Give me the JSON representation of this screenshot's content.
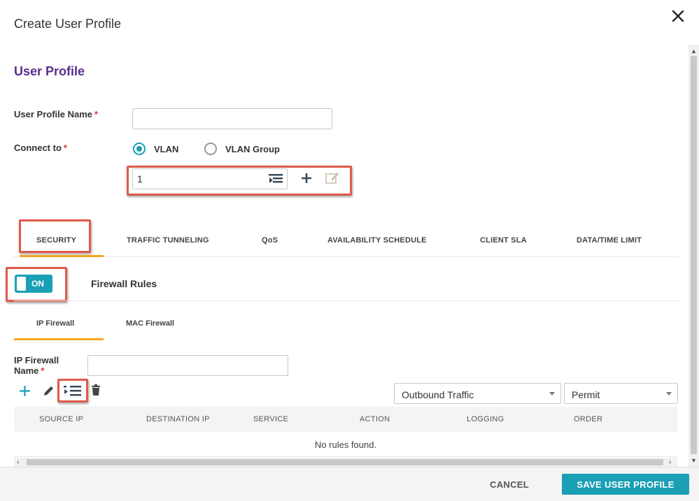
{
  "dialog": {
    "title": "Create User Profile"
  },
  "section": {
    "title": "User Profile"
  },
  "form": {
    "profile_name_label": "User Profile Name",
    "profile_name_value": "",
    "connect_label": "Connect to",
    "required_mark": "*",
    "radio_vlan": "VLAN",
    "radio_vlan_group": "VLAN Group",
    "selected": "VLAN",
    "vlan_value": "1"
  },
  "tabs": [
    {
      "label": "SECURITY",
      "active": true
    },
    {
      "label": "TRAFFIC TUNNELING"
    },
    {
      "label": "QoS"
    },
    {
      "label": "AVAILABILITY SCHEDULE"
    },
    {
      "label": "CLIENT SLA"
    },
    {
      "label": "DATA/TIME LIMIT"
    }
  ],
  "firewall": {
    "toggle_label": "ON",
    "toggle_on": true,
    "title": "Firewall Rules",
    "subtabs": [
      {
        "label": "IP Firewall",
        "active": true
      },
      {
        "label": "MAC Firewall"
      }
    ],
    "name_label": "IP Firewall Name",
    "name_value": "",
    "direction": "Outbound Traffic",
    "action": "Permit"
  },
  "table": {
    "columns": [
      "SOURCE IP",
      "DESTINATION IP",
      "SERVICE",
      "ACTION",
      "LOGGING",
      "ORDER"
    ],
    "empty_text": "No rules found."
  },
  "footer": {
    "cancel": "CANCEL",
    "save": "SAVE USER PROFILE"
  },
  "colors": {
    "accent": "#1a9fb5",
    "heading": "#5c2d91",
    "tab_underline": "#f5a623",
    "highlight": "#e05a4b"
  },
  "icons": [
    "close-icon",
    "list-select-icon",
    "plus-icon",
    "edit-icon",
    "pencil-icon",
    "trash-icon",
    "caret-down-icon"
  ]
}
